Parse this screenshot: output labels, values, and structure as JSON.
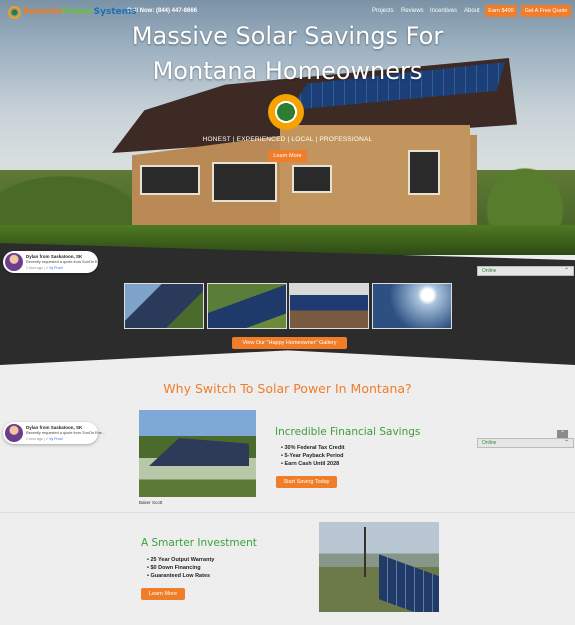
{
  "header": {
    "logo_part1": "Remote",
    "logo_part2": "Power",
    "logo_part3": "Systems",
    "phone": "Call Now: (844) 447-8666",
    "nav": [
      "Projects",
      "Reviews",
      "Incentives",
      "About"
    ],
    "earn_button": "Earn $400",
    "quote_button": "Get A Free Quote"
  },
  "hero": {
    "title_line1": "Massive Solar Savings For",
    "title_line2": "Montana Homeowners",
    "tagline": "HONEST | EXPERIENCED | LOCAL | PROFESSIONAL",
    "button": "Learn More"
  },
  "notifications": [
    {
      "name": "Dylan from Saskatoon, SK",
      "text": "Recently requested a quote from SunOn Ene...",
      "time": "1 hour ago",
      "verified": "by Proof"
    },
    {
      "name": "Dylan from Saskatoon, SK",
      "text": "Recently requested a quote from SunOn Ene...",
      "time": "1 hour ago",
      "verified": "by Proof"
    }
  ],
  "chat": {
    "status": "Online"
  },
  "gallery": {
    "button": "View Our \"Happy Homeowner\" Gallery"
  },
  "why": {
    "title": "Why Switch To Solar Power In Montana?"
  },
  "financial": {
    "title": "Incredible Financial Savings",
    "items": [
      "30% Federal Tax Credit",
      "5-Year Payback Period",
      "Earn Cash Until 2028"
    ],
    "button": "Start Saving Today",
    "photo_caption": "Baker Scott"
  },
  "investment": {
    "title": "A Smarter Investment",
    "items": [
      "25 Year Output Warranty",
      "$0 Down Financing",
      "Guaranteed Low Rates"
    ],
    "button": "Learn More"
  },
  "colors": {
    "accent": "#f07d2a",
    "green": "#3aa13a",
    "dark_band": "#2c2c2c"
  }
}
